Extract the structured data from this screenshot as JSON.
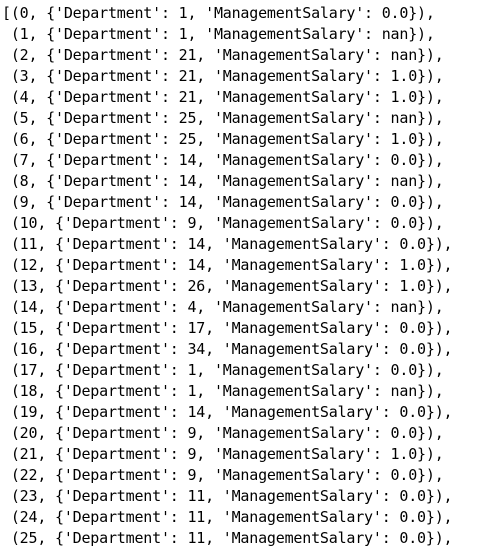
{
  "output": {
    "lines": [
      "[(0, {'Department': 1, 'ManagementSalary': 0.0}),",
      " (1, {'Department': 1, 'ManagementSalary': nan}),",
      " (2, {'Department': 21, 'ManagementSalary': nan}),",
      " (3, {'Department': 21, 'ManagementSalary': 1.0}),",
      " (4, {'Department': 21, 'ManagementSalary': 1.0}),",
      " (5, {'Department': 25, 'ManagementSalary': nan}),",
      " (6, {'Department': 25, 'ManagementSalary': 1.0}),",
      " (7, {'Department': 14, 'ManagementSalary': 0.0}),",
      " (8, {'Department': 14, 'ManagementSalary': nan}),",
      " (9, {'Department': 14, 'ManagementSalary': 0.0}),",
      " (10, {'Department': 9, 'ManagementSalary': 0.0}),",
      " (11, {'Department': 14, 'ManagementSalary': 0.0}),",
      " (12, {'Department': 14, 'ManagementSalary': 1.0}),",
      " (13, {'Department': 26, 'ManagementSalary': 1.0}),",
      " (14, {'Department': 4, 'ManagementSalary': nan}),",
      " (15, {'Department': 17, 'ManagementSalary': 0.0}),",
      " (16, {'Department': 34, 'ManagementSalary': 0.0}),",
      " (17, {'Department': 1, 'ManagementSalary': 0.0}),",
      " (18, {'Department': 1, 'ManagementSalary': nan}),",
      " (19, {'Department': 14, 'ManagementSalary': 0.0}),",
      " (20, {'Department': 9, 'ManagementSalary': 0.0}),",
      " (21, {'Department': 9, 'ManagementSalary': 1.0}),",
      " (22, {'Department': 9, 'ManagementSalary': 0.0}),",
      " (23, {'Department': 11, 'ManagementSalary': 0.0}),",
      " (24, {'Department': 11, 'ManagementSalary': 0.0}),",
      " (25, {'Department': 11, 'ManagementSalary': 0.0}),"
    ]
  }
}
